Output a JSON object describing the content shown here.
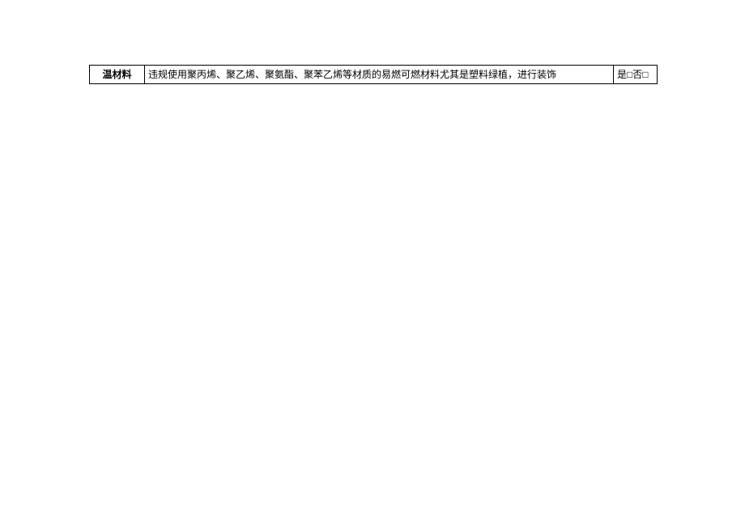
{
  "table": {
    "row": {
      "label": "温材料",
      "description": "违规使用聚丙烯、聚乙烯、聚氨酯、聚苯乙烯等材质的易燃可燃材料尤其是塑料绿植，进行装饰",
      "check": "是□否□"
    }
  }
}
